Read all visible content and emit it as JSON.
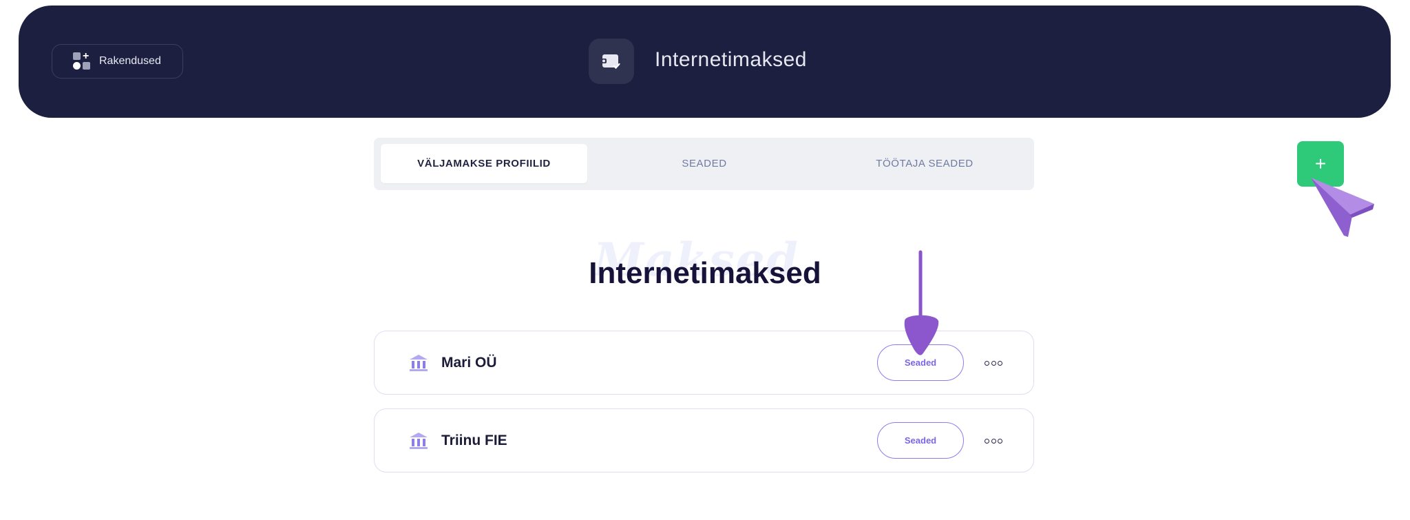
{
  "header": {
    "apps_label": "Rakendused",
    "app_title": "Internetimaksed"
  },
  "tabs": [
    {
      "label": "VÄLJAMAKSE PROFIILID",
      "active": true
    },
    {
      "label": "SEADED",
      "active": false
    },
    {
      "label": "TÖÖTAJA SEADED",
      "active": false
    }
  ],
  "add_button": {
    "label": "+"
  },
  "main": {
    "background_word": "Maksed",
    "title": "Internetimaksed"
  },
  "profiles": [
    {
      "name": "Mari OÜ",
      "button": "Seaded"
    },
    {
      "name": "Triinu FIE",
      "button": "Seaded"
    }
  ],
  "colors": {
    "header_bg": "#1c1f3f",
    "accent": "#7a66e6",
    "add_green": "#2fc97a",
    "pointer_purple": "#9b6bd6"
  }
}
